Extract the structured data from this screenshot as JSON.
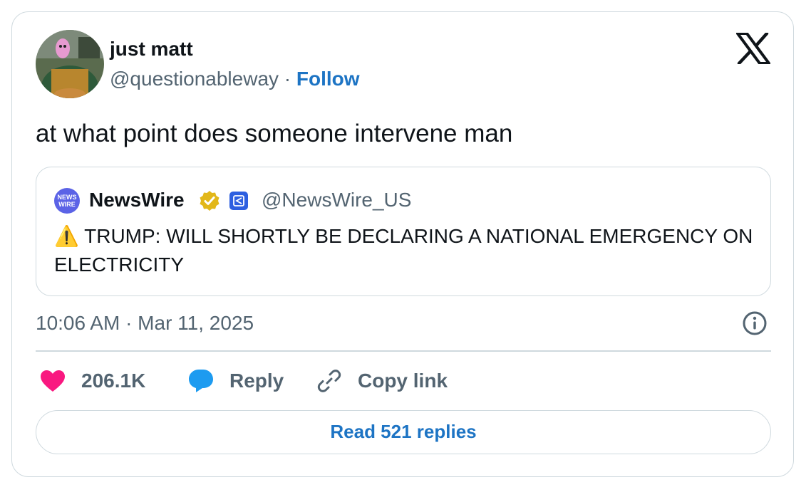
{
  "author": {
    "display_name": "just matt",
    "handle": "@questionableway",
    "separator": " · ",
    "follow_label": "Follow"
  },
  "tweet": {
    "text": "at what point does someone intervene man",
    "timestamp": "10:06 AM · Mar 11, 2025"
  },
  "quoted_tweet": {
    "avatar_text_line1": "NEWS",
    "avatar_text_line2": "WIRE",
    "display_name": "NewsWire",
    "handle": "@NewsWire_US",
    "text": "⚠️ TRUMP: WILL SHORTLY BE DECLARING A NATIONAL EMERGENCY ON ELECTRICITY"
  },
  "actions": {
    "like_count": "206.1K",
    "reply_label": "Reply",
    "copy_link_label": "Copy link"
  },
  "read_replies_label": "Read 521 replies",
  "colors": {
    "accent": "#1d74c4",
    "like": "#f91880",
    "reply": "#1d9bf0",
    "secondary_text": "#536471",
    "border": "#cfd9de"
  },
  "icons": [
    "x-logo-icon",
    "verified-badge-icon",
    "affiliate-badge-icon",
    "info-icon",
    "heart-icon",
    "reply-bubble-icon",
    "link-icon"
  ]
}
